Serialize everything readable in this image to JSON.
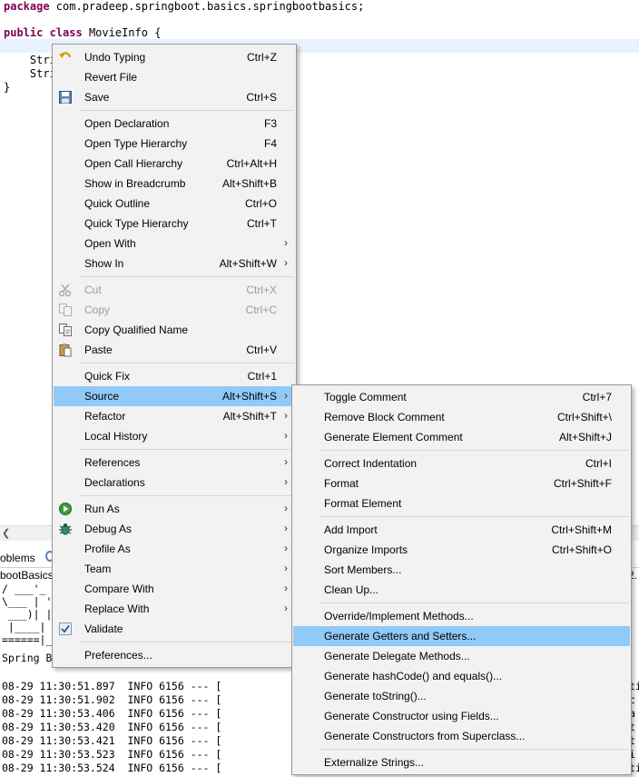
{
  "editor": {
    "package_kw": "package",
    "package_name": " com.pradeep.springboot.basics.springbootbasics;",
    "public_kw": "public",
    "class_kw": "class",
    "class_name": " MovieInfo {",
    "line_field1": "    Stri",
    "line_field2": "    Stri",
    "closing": "}"
  },
  "views": {
    "problems_tab": "oblems",
    "console_title": "bootBasics.",
    "console_title_right": "2.",
    "banner": [
      "/ ___'_",
      "\\___ | '",
      " ___)| |",
      " |____| .",
      "======|_|",
      "Spring Bo"
    ],
    "logs": [
      "08-29 11:30:51.897  INFO 6156 --- [",
      "08-29 11:30:51.902  INFO 6156 --- [",
      "08-29 11:30:53.406  INFO 6156 --- [",
      "08-29 11:30:53.420  INFO 6156 --- [",
      "08-29 11:30:53.421  INFO 6156 --- [",
      "08-29 11:30:53.523  INFO 6156 --- [",
      "08-29 11:30:53.524  INFO 6156 --- ["
    ],
    "log_edges": [
      "ti",
      "c",
      "a",
      "t",
      "t",
      "i",
      "ti"
    ]
  },
  "main_menu": {
    "items": [
      {
        "label": "Undo Typing",
        "acc": "Ctrl+Z"
      },
      {
        "label": "Revert File",
        "acc": ""
      },
      {
        "label": "Save",
        "acc": "Ctrl+S"
      },
      {
        "label": "Open Declaration",
        "acc": "F3"
      },
      {
        "label": "Open Type Hierarchy",
        "acc": "F4"
      },
      {
        "label": "Open Call Hierarchy",
        "acc": "Ctrl+Alt+H"
      },
      {
        "label": "Show in Breadcrumb",
        "acc": "Alt+Shift+B"
      },
      {
        "label": "Quick Outline",
        "acc": "Ctrl+O"
      },
      {
        "label": "Quick Type Hierarchy",
        "acc": "Ctrl+T"
      },
      {
        "label": "Open With",
        "acc": ""
      },
      {
        "label": "Show In",
        "acc": "Alt+Shift+W"
      },
      {
        "label": "Cut",
        "acc": "Ctrl+X"
      },
      {
        "label": "Copy",
        "acc": "Ctrl+C"
      },
      {
        "label": "Copy Qualified Name",
        "acc": ""
      },
      {
        "label": "Paste",
        "acc": "Ctrl+V"
      },
      {
        "label": "Quick Fix",
        "acc": "Ctrl+1"
      },
      {
        "label": "Source",
        "acc": "Alt+Shift+S"
      },
      {
        "label": "Refactor",
        "acc": "Alt+Shift+T"
      },
      {
        "label": "Local History",
        "acc": ""
      },
      {
        "label": "References",
        "acc": ""
      },
      {
        "label": "Declarations",
        "acc": ""
      },
      {
        "label": "Run As",
        "acc": ""
      },
      {
        "label": "Debug As",
        "acc": ""
      },
      {
        "label": "Profile As",
        "acc": ""
      },
      {
        "label": "Team",
        "acc": ""
      },
      {
        "label": "Compare With",
        "acc": ""
      },
      {
        "label": "Replace With",
        "acc": ""
      },
      {
        "label": "Validate",
        "acc": ""
      },
      {
        "label": "Preferences...",
        "acc": ""
      }
    ]
  },
  "source_menu": {
    "items": [
      {
        "label": "Toggle Comment",
        "acc": "Ctrl+7"
      },
      {
        "label": "Remove Block Comment",
        "acc": "Ctrl+Shift+\\"
      },
      {
        "label": "Generate Element Comment",
        "acc": "Alt+Shift+J"
      },
      {
        "label": "Correct Indentation",
        "acc": "Ctrl+I"
      },
      {
        "label": "Format",
        "acc": "Ctrl+Shift+F"
      },
      {
        "label": "Format Element",
        "acc": ""
      },
      {
        "label": "Add Import",
        "acc": "Ctrl+Shift+M"
      },
      {
        "label": "Organize Imports",
        "acc": "Ctrl+Shift+O"
      },
      {
        "label": "Sort Members...",
        "acc": ""
      },
      {
        "label": "Clean Up...",
        "acc": ""
      },
      {
        "label": "Override/Implement Methods...",
        "acc": ""
      },
      {
        "label": "Generate Getters and Setters...",
        "acc": ""
      },
      {
        "label": "Generate Delegate Methods...",
        "acc": ""
      },
      {
        "label": "Generate hashCode() and equals()...",
        "acc": ""
      },
      {
        "label": "Generate toString()...",
        "acc": ""
      },
      {
        "label": "Generate Constructor using Fields...",
        "acc": ""
      },
      {
        "label": "Generate Constructors from Superclass...",
        "acc": ""
      },
      {
        "label": "Externalize Strings...",
        "acc": ""
      }
    ]
  },
  "colors": {
    "keyword": "#7f0055",
    "highlight": "#91c9f7",
    "menu_bg": "#f2f2f2",
    "disabled": "#9b9b9b"
  },
  "icons": {
    "undo": "undo-icon",
    "save": "save-icon",
    "cut": "cut-icon",
    "copy": "copy-icon",
    "copy_qualified": "copy-qualified-name-icon",
    "paste": "paste-icon",
    "run": "run-icon",
    "debug": "debug-icon",
    "validate": "checkmark-icon",
    "submenu": "chevron-right-icon"
  }
}
